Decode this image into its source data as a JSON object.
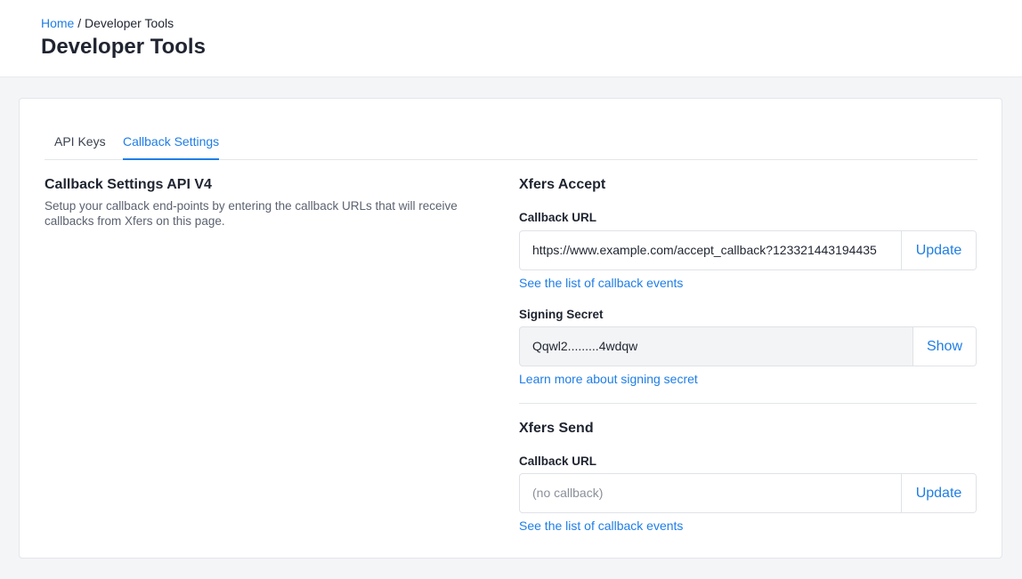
{
  "breadcrumb": {
    "home": "Home",
    "separator": " / ",
    "current": "Developer Tools"
  },
  "page": {
    "title": "Developer Tools"
  },
  "tabs": [
    {
      "label": "API Keys",
      "active": false
    },
    {
      "label": "Callback Settings",
      "active": true
    }
  ],
  "left": {
    "title": "Callback Settings API V4",
    "description": "Setup your callback end-points by entering the callback URLs that will receive callbacks from Xfers on this page."
  },
  "accept": {
    "title": "Xfers Accept",
    "callback_label": "Callback URL",
    "callback_value": "https://www.example.com/accept_callback?123321443194435",
    "update_label": "Update",
    "events_link": "See the list of callback events",
    "secret_label": "Signing Secret",
    "secret_value": "Qqwl2.........4wdqw",
    "show_label": "Show",
    "secret_link": "Learn more about signing secret"
  },
  "send": {
    "title": "Xfers Send",
    "callback_label": "Callback URL",
    "callback_placeholder": "(no callback)",
    "update_label": "Update",
    "events_link": "See the list of callback events"
  },
  "colors": {
    "accent": "#1f7ee6",
    "text": "#1f2430",
    "muted": "#5b6270",
    "background": "#f4f5f7"
  }
}
